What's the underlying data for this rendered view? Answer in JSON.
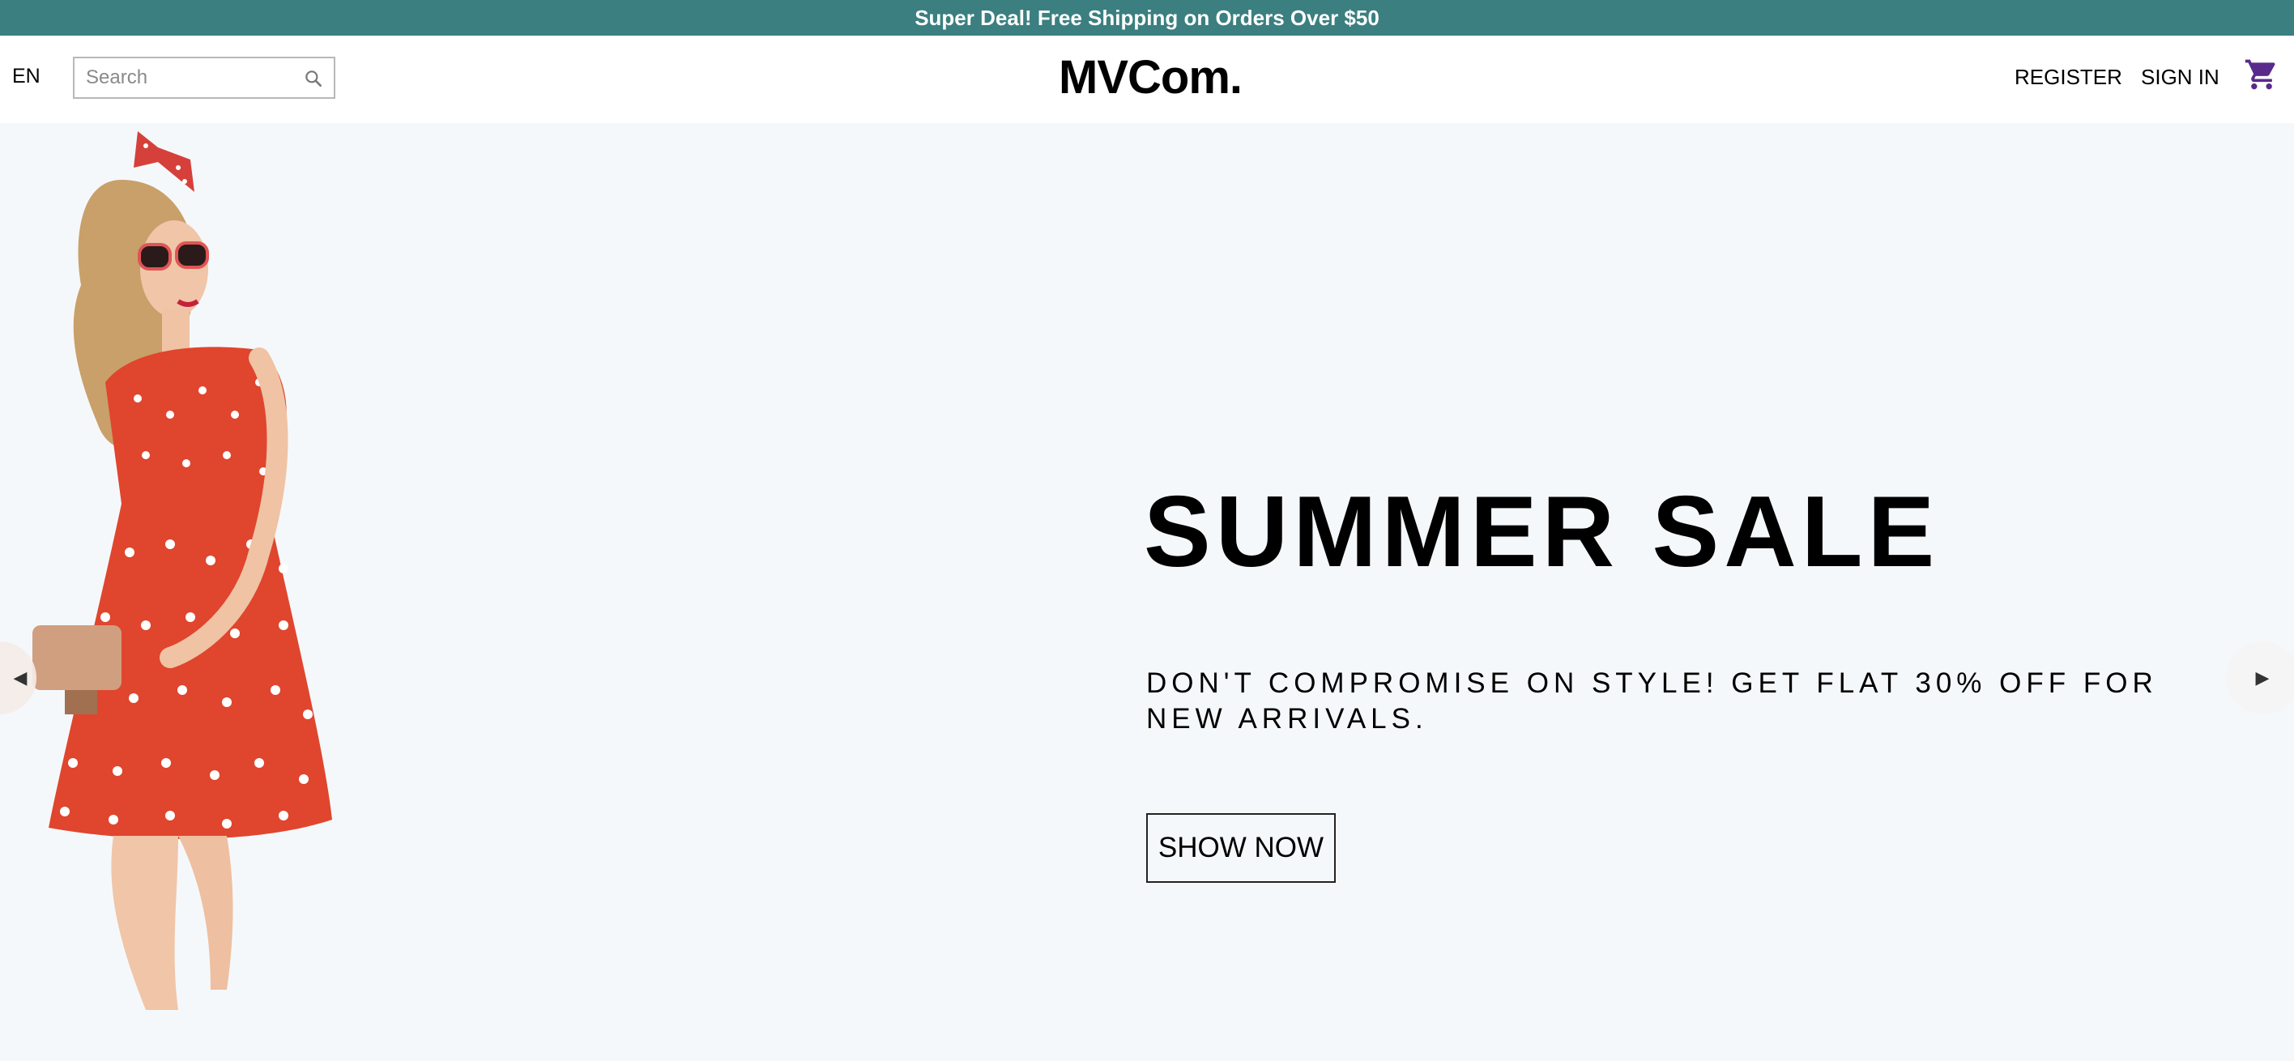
{
  "announcement": {
    "text": "Super Deal! Free Shipping on Orders Over $50"
  },
  "header": {
    "language": "EN",
    "search": {
      "placeholder": "Search",
      "value": "",
      "icon": "search-icon"
    },
    "logo": "MVCom.",
    "nav": {
      "register": "REGISTER",
      "sign_in": "SIGN IN"
    },
    "cart_icon": "shopping-cart-icon"
  },
  "hero": {
    "title": "SUMMER SALE",
    "description": "DON'T COMPROMISE ON STYLE! GET FLAT 30% OFF FOR NEW ARRIVALS.",
    "cta": "SHOW NOW",
    "prev_icon": "arrow-left-icon",
    "next_icon": "arrow-right-icon"
  },
  "colors": {
    "announcement_bg": "#3b7f80",
    "page_bg": "#f5f8fa",
    "cart_icon": "#5a2a8a",
    "dress": "#e0452e"
  }
}
